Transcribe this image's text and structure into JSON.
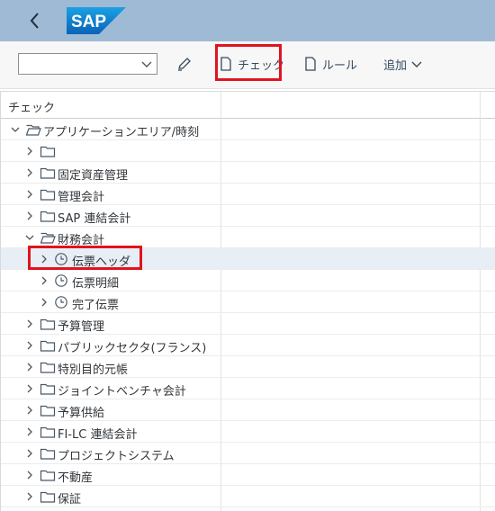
{
  "shell": {
    "logo_text": "SAP"
  },
  "toolbar": {
    "select_value": "",
    "check_label": "チェック",
    "rule_label": "ルール",
    "add_label": "追加"
  },
  "grid": {
    "header_col1": "チェック"
  },
  "rows": [
    {
      "label": "アプリケーションエリア/時刻",
      "level": 0,
      "expanded": true,
      "icon": "open-folder-icon"
    },
    {
      "label": "",
      "level": 1,
      "expanded": false,
      "icon": "folder-icon"
    },
    {
      "label": "固定資産管理",
      "level": 1,
      "expanded": false,
      "icon": "folder-icon"
    },
    {
      "label": "管理会計",
      "level": 1,
      "expanded": false,
      "icon": "folder-icon"
    },
    {
      "label": "SAP 連結会計",
      "level": 1,
      "expanded": false,
      "icon": "folder-icon"
    },
    {
      "label": "財務会計",
      "level": 1,
      "expanded": true,
      "icon": "open-folder-icon"
    },
    {
      "label": "伝票ヘッダ",
      "level": 2,
      "expanded": false,
      "icon": "clock-icon",
      "selected": true
    },
    {
      "label": "伝票明細",
      "level": 2,
      "expanded": false,
      "icon": "clock-icon"
    },
    {
      "label": "完了伝票",
      "level": 2,
      "expanded": false,
      "icon": "clock-icon"
    },
    {
      "label": "予算管理",
      "level": 1,
      "expanded": false,
      "icon": "folder-icon"
    },
    {
      "label": "パブリックセクタ(フランス)",
      "level": 1,
      "expanded": false,
      "icon": "folder-icon"
    },
    {
      "label": "特別目的元帳",
      "level": 1,
      "expanded": false,
      "icon": "folder-icon"
    },
    {
      "label": "ジョイントベンチャ会計",
      "level": 1,
      "expanded": false,
      "icon": "folder-icon"
    },
    {
      "label": "予算供給",
      "level": 1,
      "expanded": false,
      "icon": "folder-icon"
    },
    {
      "label": "FI-LC 連結会計",
      "level": 1,
      "expanded": false,
      "icon": "folder-icon"
    },
    {
      "label": "プロジェクトシステム",
      "level": 1,
      "expanded": false,
      "icon": "folder-icon"
    },
    {
      "label": "不動産",
      "level": 1,
      "expanded": false,
      "icon": "folder-icon"
    },
    {
      "label": "保証",
      "level": 1,
      "expanded": false,
      "icon": "folder-icon"
    }
  ],
  "colors": {
    "shellbar": "#9fbad4",
    "highlight": "#e0141f",
    "selected_row": "#e8eef5"
  }
}
